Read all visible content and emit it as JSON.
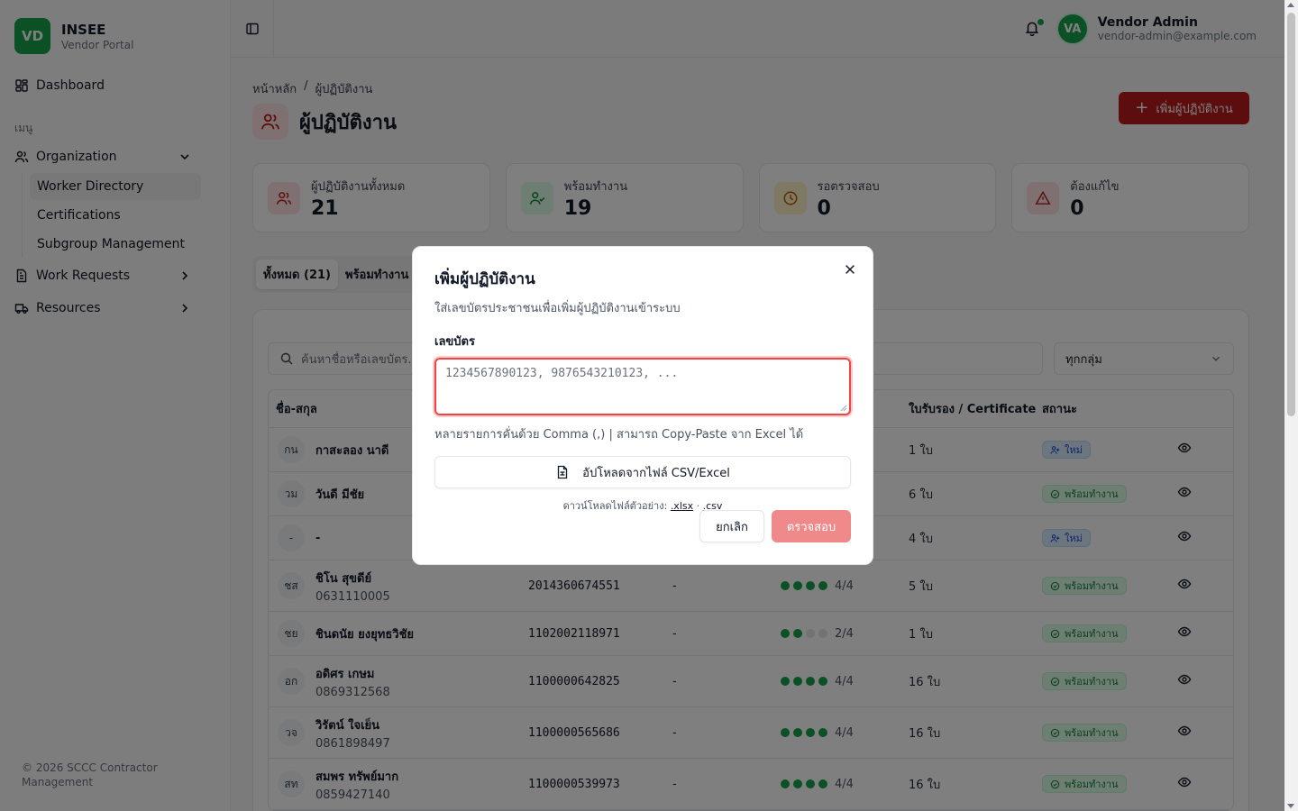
{
  "brand": {
    "logo": "VD",
    "name": "INSEE",
    "subtitle": "Vendor Portal"
  },
  "sidebar": {
    "dashboard": "Dashboard",
    "menu_label": "เมนู",
    "organization": "Organization",
    "sub_items": [
      "Worker Directory",
      "Certifications",
      "Subgroup Management"
    ],
    "work_requests": "Work Requests",
    "resources": "Resources",
    "footer": "© 2026 SCCC Contractor Management"
  },
  "header": {
    "user_initials": "VA",
    "user_name": "Vendor Admin",
    "user_email": "vendor-admin@example.com"
  },
  "main": {
    "breadcrumb": [
      "หน้าหลัก",
      "/",
      "ผู้ปฏิบัติงาน"
    ],
    "title": "ผู้ปฏิบัติงาน",
    "add_button": "เพิ่มผู้ปฏิบัติงาน",
    "stats": [
      {
        "label": "ผู้ปฏิบัติงานทั้งหมด",
        "value": "21",
        "color": "#fee2e2",
        "icon": "users-icon"
      },
      {
        "label": "พร้อมทำงาน",
        "value": "19",
        "color": "#dcfce7",
        "icon": "user-check-icon"
      },
      {
        "label": "รอตรวจสอบ",
        "value": "0",
        "color": "#fef3c7",
        "icon": "clock-icon"
      },
      {
        "label": "ต้องแก้ไข",
        "value": "0",
        "color": "#fee2e2",
        "icon": "alert-icon"
      }
    ],
    "tabs": [
      "ทั้งหมด (21)",
      "พร้อมทำงาน ("
    ],
    "search_placeholder": "ค้นหาชื่อหรือเลขบัตร...",
    "group_select": "ทุกกลุ่ม",
    "columns": {
      "name": "ชื่อ-สกุล",
      "cert": "ใบรับรอง / Certificate",
      "status": "สถานะ"
    },
    "rows": [
      {
        "initials": "กน",
        "name": "กาสะลอง นาดี",
        "phone": "",
        "id": "",
        "dept": "",
        "score": "",
        "certs": "1 ใบ",
        "status": "ใหม่",
        "status_type": "new"
      },
      {
        "initials": "วม",
        "name": "วันดี มีชัย",
        "phone": "",
        "id": "",
        "dept": "",
        "score": "",
        "certs": "6 ใบ",
        "status": "พร้อมทำงาน",
        "status_type": "ready"
      },
      {
        "initials": "-",
        "name": "-",
        "phone": "",
        "id": "",
        "dept": "",
        "score": "",
        "certs": "4 ใบ",
        "status": "ใหม่",
        "status_type": "new"
      },
      {
        "initials": "ชส",
        "name": "ชิโน สุขดีย์",
        "phone": "0631110005",
        "id": "2014360674551",
        "dept": "-",
        "score": "4/4",
        "filled": 4,
        "certs": "5 ใบ",
        "status": "พร้อมทำงาน",
        "status_type": "ready"
      },
      {
        "initials": "ชย",
        "name": "ชินดนัย ยงยุทธวิชัย",
        "phone": "",
        "id": "1102002118971",
        "dept": "-",
        "score": "2/4",
        "filled": 2,
        "certs": "1 ใบ",
        "status": "พร้อมทำงาน",
        "status_type": "ready"
      },
      {
        "initials": "อก",
        "name": "อดิศร เกษม",
        "phone": "0869312568",
        "id": "1100000642825",
        "dept": "-",
        "score": "4/4",
        "filled": 4,
        "certs": "16 ใบ",
        "status": "พร้อมทำงาน",
        "status_type": "ready"
      },
      {
        "initials": "วจ",
        "name": "วิรัตน์ ใจเย็น",
        "phone": "0861898497",
        "id": "1100000565686",
        "dept": "-",
        "score": "4/4",
        "filled": 4,
        "certs": "16 ใบ",
        "status": "พร้อมทำงาน",
        "status_type": "ready"
      },
      {
        "initials": "สท",
        "name": "สมพร ทรัพย์มาก",
        "phone": "0859427140",
        "id": "1100000539973",
        "dept": "-",
        "score": "4/4",
        "filled": 4,
        "certs": "16 ใบ",
        "status": "พร้อมทำงาน",
        "status_type": "ready"
      }
    ]
  },
  "modal": {
    "title": "เพิ่มผู้ปฏิบัติงาน",
    "description": "ใส่เลขบัตรประชาชนเพื่อเพิ่มผู้ปฏิบัติงานเข้าระบบ",
    "field_label": "เลขบัตร",
    "textarea_placeholder": "1234567890123, 9876543210123, ...",
    "hint": "หลายรายการคั่นด้วย Comma (,) | สามารถ Copy-Paste จาก Excel ได้",
    "upload_label": "อัปโหลดจากไฟล์ CSV/Excel",
    "download_prefix": "ดาวน์โหลดไฟล์ตัวอย่าง:",
    "download_xlsx": ".xlsx",
    "download_sep": "·",
    "download_csv": ".csv",
    "cancel": "ยกเลิก",
    "verify": "ตรวจสอบ"
  },
  "colors": {
    "brand_green": "#16a34a",
    "primary_red": "#b91c1c",
    "verify_disabled": "#f08a8a"
  }
}
